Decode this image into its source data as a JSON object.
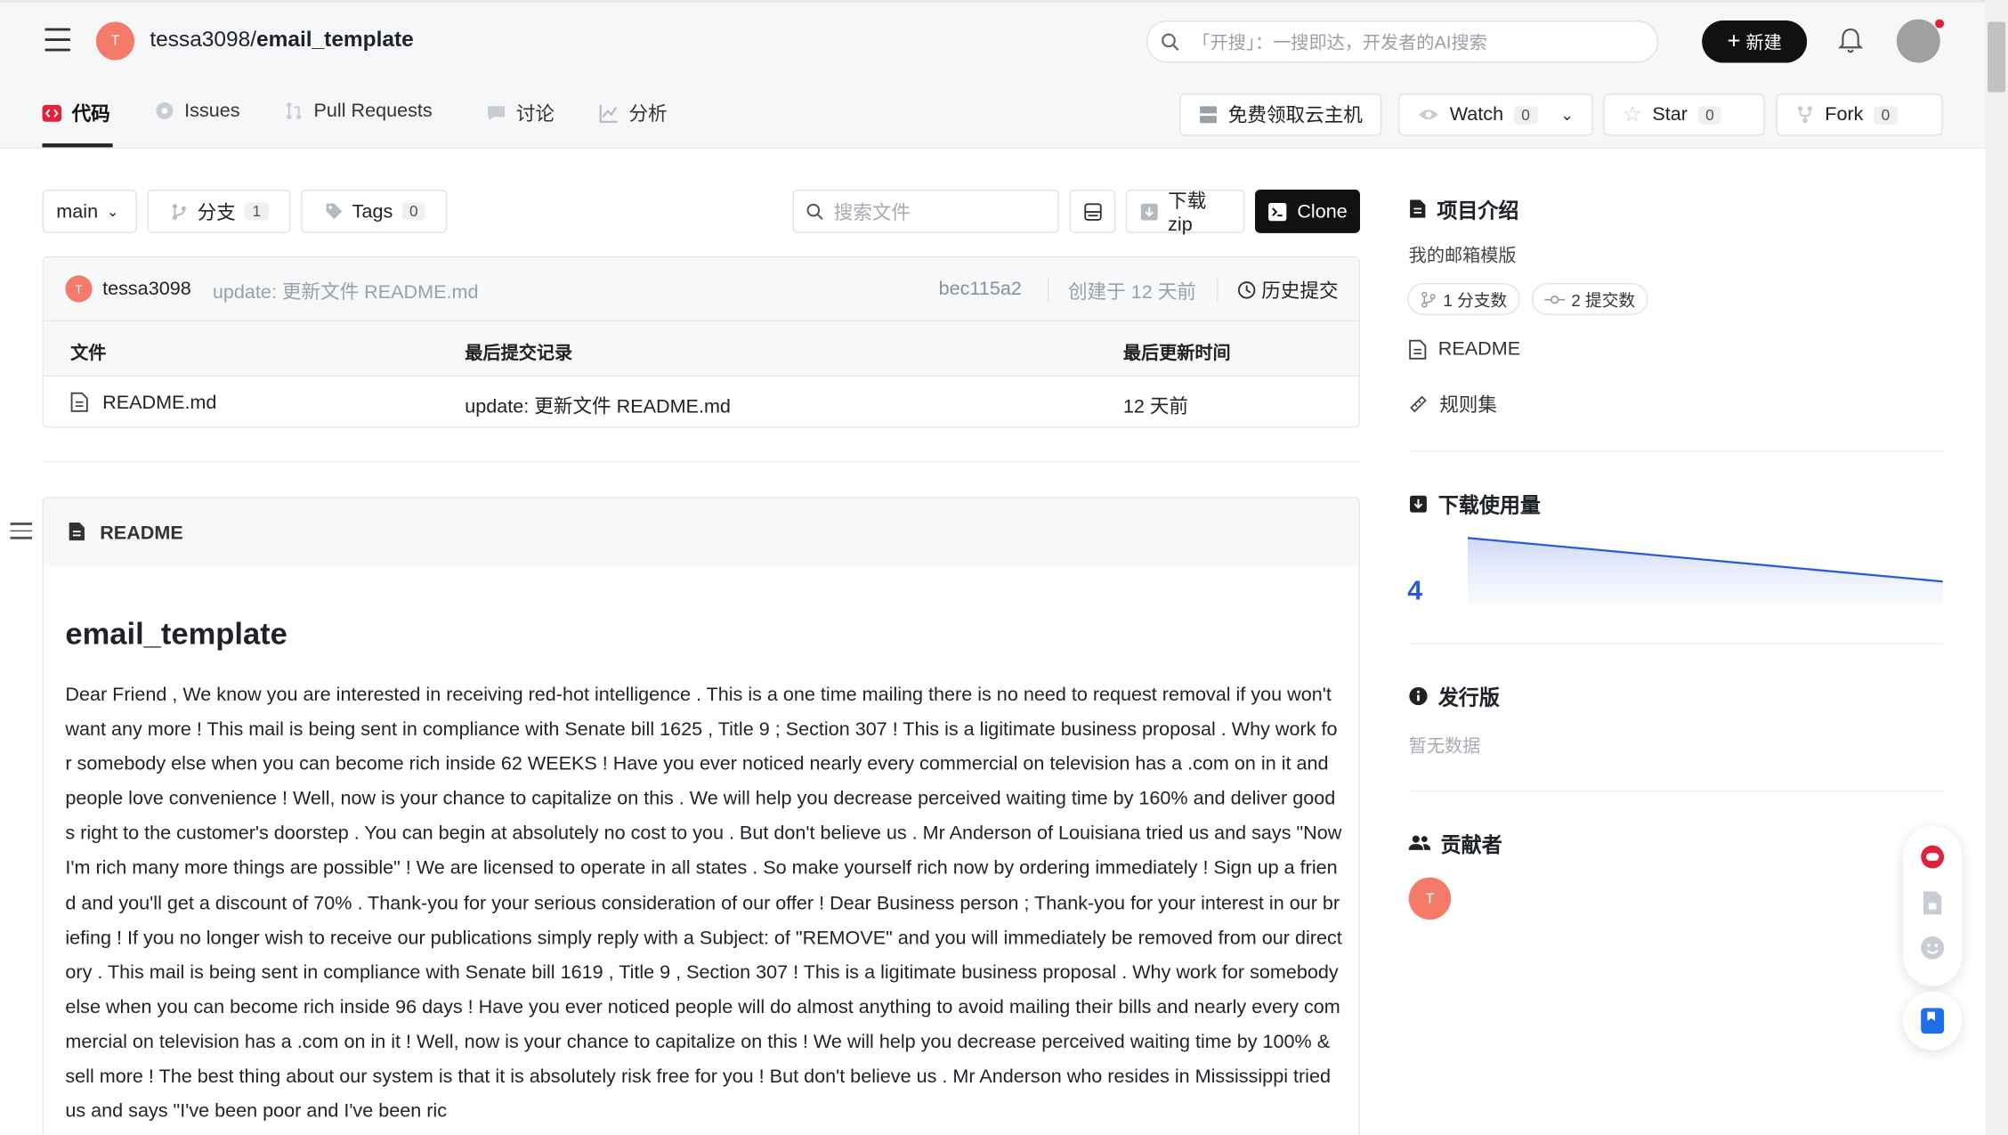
{
  "header": {
    "avatar_initial": "T",
    "owner": "tessa3098",
    "separator": "/",
    "repo": "email_template",
    "search_placeholder": "「开搜」：一搜即达，开发者的AI搜索",
    "new_button": "新建"
  },
  "tabs": [
    {
      "label": "代码",
      "icon": "code-icon"
    },
    {
      "label": "Issues",
      "icon": "issue-icon"
    },
    {
      "label": "Pull Requests",
      "icon": "pull-request-icon"
    },
    {
      "label": "讨论",
      "icon": "discussion-icon"
    },
    {
      "label": "分析",
      "icon": "chart-icon"
    }
  ],
  "actions": {
    "cloud": "免费领取云主机",
    "watch": "Watch",
    "watch_count": "0",
    "star": "Star",
    "star_count": "0",
    "fork": "Fork",
    "fork_count": "0"
  },
  "toolbar": {
    "branch": "main",
    "branches_label": "分支",
    "branches_count": "1",
    "tags_label": "Tags",
    "tags_count": "0",
    "search_placeholder": "搜索文件",
    "download": "下载zip",
    "clone": "Clone"
  },
  "commit": {
    "avatar_initial": "T",
    "user": "tessa3098",
    "message": "update: 更新文件 README.md",
    "sha": "bec115a2",
    "time": "创建于 12 天前",
    "history": "历史提交"
  },
  "files": {
    "headers": [
      "文件",
      "最后提交记录",
      "最后更新时间"
    ],
    "rows": [
      {
        "name": "README.md",
        "commit": "update: 更新文件 README.md",
        "time": "12 天前"
      }
    ]
  },
  "readme": {
    "label": "README",
    "title": "email_template",
    "body": "Dear Friend , We know you are interested in receiving red-hot intelligence . This is a one time mailing there is no need to request removal if you won't want any more ! This mail is being sent in compliance with Senate bill 1625 , Title 9 ; Section 307 ! This is a ligitimate business proposal . Why work for somebody else when you can become rich inside 62 WEEKS ! Have you ever noticed nearly every commercial on television has a .com on in it and people love convenience ! Well, now is your chance to capitalize on this . We will help you decrease perceived waiting time by 160% and deliver goods right to the customer's doorstep . You can begin at absolutely no cost to you . But don't believe us . Mr Anderson of Louisiana tried us and says \"Now I'm rich many more things are possible\" ! We are licensed to operate in all states . So make yourself rich now by ordering immediately ! Sign up a friend and you'll get a discount of 70% . Thank-you for your serious consideration of our offer ! Dear Business person ; Thank-you for your interest in our briefing ! If you no longer wish to receive our publications simply reply with a Subject: of \"REMOVE\" and you will immediately be removed from our directory . This mail is being sent in compliance with Senate bill 1619 , Title 9 , Section 307 ! This is a ligitimate business proposal . Why work for somebody else when you can become rich inside 96 days ! Have you ever noticed people will do almost anything to avoid mailing their bills and nearly every commercial on television has a .com on in it ! Well, now is your chance to capitalize on this ! We will help you decrease perceived waiting time by 100% & sell more ! The best thing about our system is that it is absolutely risk free for you ! But don't believe us . Mr Anderson who resides in Mississippi tried us and says \"I've been poor and I've been ric"
  },
  "sidebar": {
    "intro_title": "项目介绍",
    "description": "我的邮箱模版",
    "branches_pill": "1 分支数",
    "commits_pill": "2 提交数",
    "readme_link": "README",
    "rules_link": "规则集",
    "downloads_title": "下载使用量",
    "downloads_count": "4",
    "releases_title": "发行版",
    "releases_empty": "暂无数据",
    "contributors_title": "贡献者",
    "contributor_initial": "T"
  },
  "colors": {
    "accent_dark": "#111111",
    "avatar": "#f47a6a",
    "chart_blue": "#2a5bd7"
  }
}
